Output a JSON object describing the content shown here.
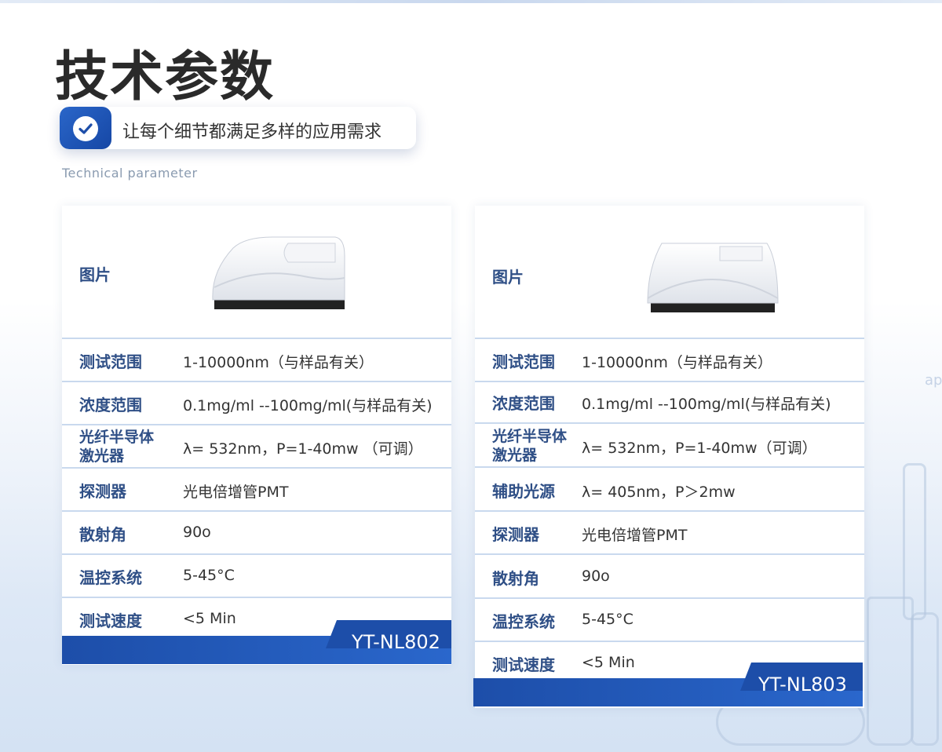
{
  "header": {
    "title": "技术参数",
    "tagline": "让每个细节都满足多样的应用需求",
    "subtitle": "Technical parameter"
  },
  "background_text": "ap",
  "cards": [
    {
      "image_label": "图片",
      "model": "YT-NL802",
      "rows": [
        {
          "label": "测试范围",
          "value": "1-10000nm（与样品有关）"
        },
        {
          "label": "浓度范围",
          "value": "0.1mg/ml --100mg/ml(与样品有关)"
        },
        {
          "label": "光纤半导体激光器",
          "value": "λ= 532nm，P=1-40mw （可调）"
        },
        {
          "label": "探测器",
          "value": "光电倍增管PMT"
        },
        {
          "label": "散射角",
          "value": "90o"
        },
        {
          "label": "温控系统",
          "value": "5-45°C"
        },
        {
          "label": "测试速度",
          "value": "<5 Min"
        }
      ]
    },
    {
      "image_label": "图片",
      "model": "YT-NL803",
      "rows": [
        {
          "label": "测试范围",
          "value": "1-10000nm（与样品有关）"
        },
        {
          "label": "浓度范围",
          "value": "0.1mg/ml --100mg/ml(与样品有关)"
        },
        {
          "label": "光纤半导体激光器",
          "value": "λ= 532nm，P=1-40mw（可调）"
        },
        {
          "label": "辅助光源",
          "value": "λ= 405nm，P＞2mw"
        },
        {
          "label": "探测器",
          "value": "光电倍增管PMT"
        },
        {
          "label": "散射角",
          "value": "90o"
        },
        {
          "label": "温控系统",
          "value": "5-45°C"
        },
        {
          "label": "测试速度",
          "value": "<5 Min"
        }
      ]
    }
  ],
  "colors": {
    "accent": "#1d4ea9",
    "label": "#2f4f86",
    "divider": "#c9d9ee"
  }
}
